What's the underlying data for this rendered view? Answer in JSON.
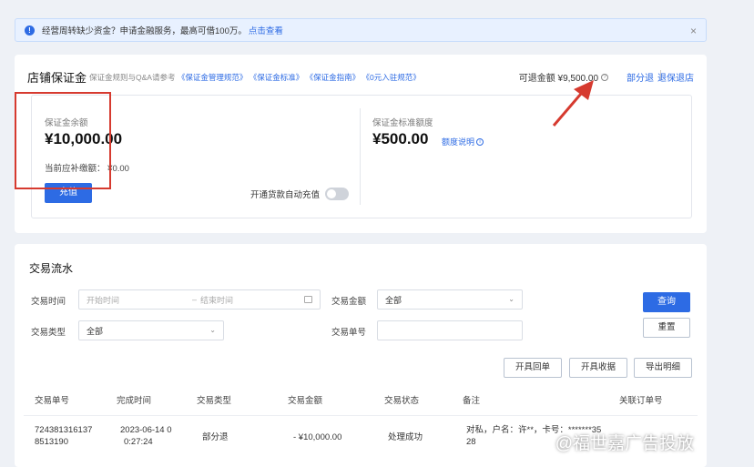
{
  "notice": {
    "text": "经营周转缺少资金？申请金融服务，最高可借100万。",
    "link": "点击查看"
  },
  "deposit": {
    "title": "店铺保证金",
    "sub_prefix": "保证金规则与Q&A请参考",
    "sub_links": [
      "《保证金管理规范》",
      "《保证金标准》",
      "《保证金指南》",
      "《0元入驻规范》"
    ],
    "refundable": "可退金额 ¥9,500.00",
    "part_refund": "部分退",
    "close_shop": "退保退店",
    "balance_label": "保证金余额",
    "balance": "¥10,000.00",
    "due_label": "当前应补缴额：",
    "due_value": "¥0.00",
    "recharge": "充值",
    "auto_recharge": "开通货款自动充值",
    "standard_label": "保证金标准额度",
    "standard": "¥500.00",
    "quota_link": "额度说明"
  },
  "flow": {
    "title": "交易流水",
    "time_label": "交易时间",
    "start_placeholder": "开始时间",
    "end_placeholder": "结束时间",
    "amount_label": "交易金额",
    "amount_value": "全部",
    "type_label": "交易类型",
    "type_value": "全部",
    "order_label": "交易单号",
    "query": "查询",
    "reset": "重置",
    "actions": [
      "开具回单",
      "开具收据",
      "导出明细"
    ],
    "columns": [
      "交易单号",
      "完成时间",
      "交易类型",
      "交易金额",
      "交易状态",
      "备注",
      "关联订单号"
    ],
    "rows": [
      {
        "order_no_1": "724381316137",
        "order_no_2": "8513190",
        "time_1": "2023-06-14 0",
        "time_2": "0:27:24",
        "type": "部分退",
        "amount": "- ¥10,000.00",
        "status": "处理成功",
        "note_1": "对私，户名：许**，卡号：*******35",
        "note_2": "28",
        "related": ""
      }
    ]
  },
  "watermark": "@福世嘉广告投放",
  "colors": {
    "accent": "#2d6be4",
    "annotation": "#d63a2f"
  }
}
